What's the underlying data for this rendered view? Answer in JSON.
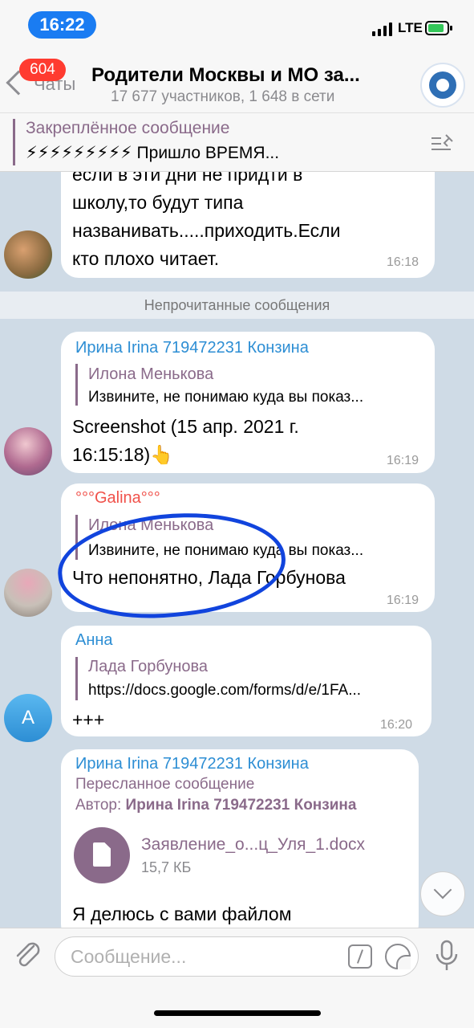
{
  "status_bar": {
    "time": "16:22",
    "network": "LTE"
  },
  "header": {
    "back_label": "Чаты",
    "unread_count": "604",
    "title": "Родители Москвы и МО за...",
    "subtitle": "17 677 участников, 1 648 в сети"
  },
  "pinned": {
    "title": "Закреплённое сообщение",
    "preview": "⚡⚡⚡⚡⚡⚡⚡⚡⚡ Пришло ВРЕМЯ..."
  },
  "messages": {
    "m1": {
      "text_lines": [
        "если в эти дни не придти в",
        "школу,то будут типа",
        "названивать.....приходить.Если",
        "кто плохо читает."
      ],
      "time": "16:18"
    },
    "unread_divider": "Непрочитанные сообщения",
    "m2": {
      "sender": "Ирина Irina 719472231 Конзина",
      "sender_color": "#2d8ed4",
      "reply_name": "Илона Менькова",
      "reply_text": "Извините, не понимаю куда вы показ...",
      "text_lines": [
        "Screenshot (15 апр. 2021 г.",
        "16:15:18)👆"
      ],
      "time": "16:19"
    },
    "m3": {
      "sender": "°°°Galina°°°",
      "sender_color": "#f0514a",
      "reply_name": "Илона Менькова",
      "reply_text": "Извините, не понимаю куда вы показ...",
      "text": "Что непонятно, Лада Горбунова",
      "time": "16:19"
    },
    "m4": {
      "sender": "Анна",
      "sender_color": "#2d8ed4",
      "avatar_letter": "А",
      "reply_name": "Лада Горбунова",
      "reply_text": "https://docs.google.com/forms/d/e/1FA...",
      "text": "+++",
      "time": "16:20"
    },
    "m5": {
      "sender": "Ирина Irina 719472231 Конзина",
      "forwarded_label": "Пересланное сообщение",
      "author_label": "Автор:",
      "author_name": "Ирина Irina 719472231 Конзина",
      "file_name": "Заявление_о...ц_Уля_1.docx",
      "file_size": "15,7 КБ",
      "text": "Я делюсь с вами файлом"
    }
  },
  "input": {
    "placeholder": "Сообщение..."
  },
  "colors": {
    "accent": "#1a7cf2",
    "badge": "#ff3b30",
    "reply": "#8a6a8a",
    "annotation": "#1144dd"
  }
}
